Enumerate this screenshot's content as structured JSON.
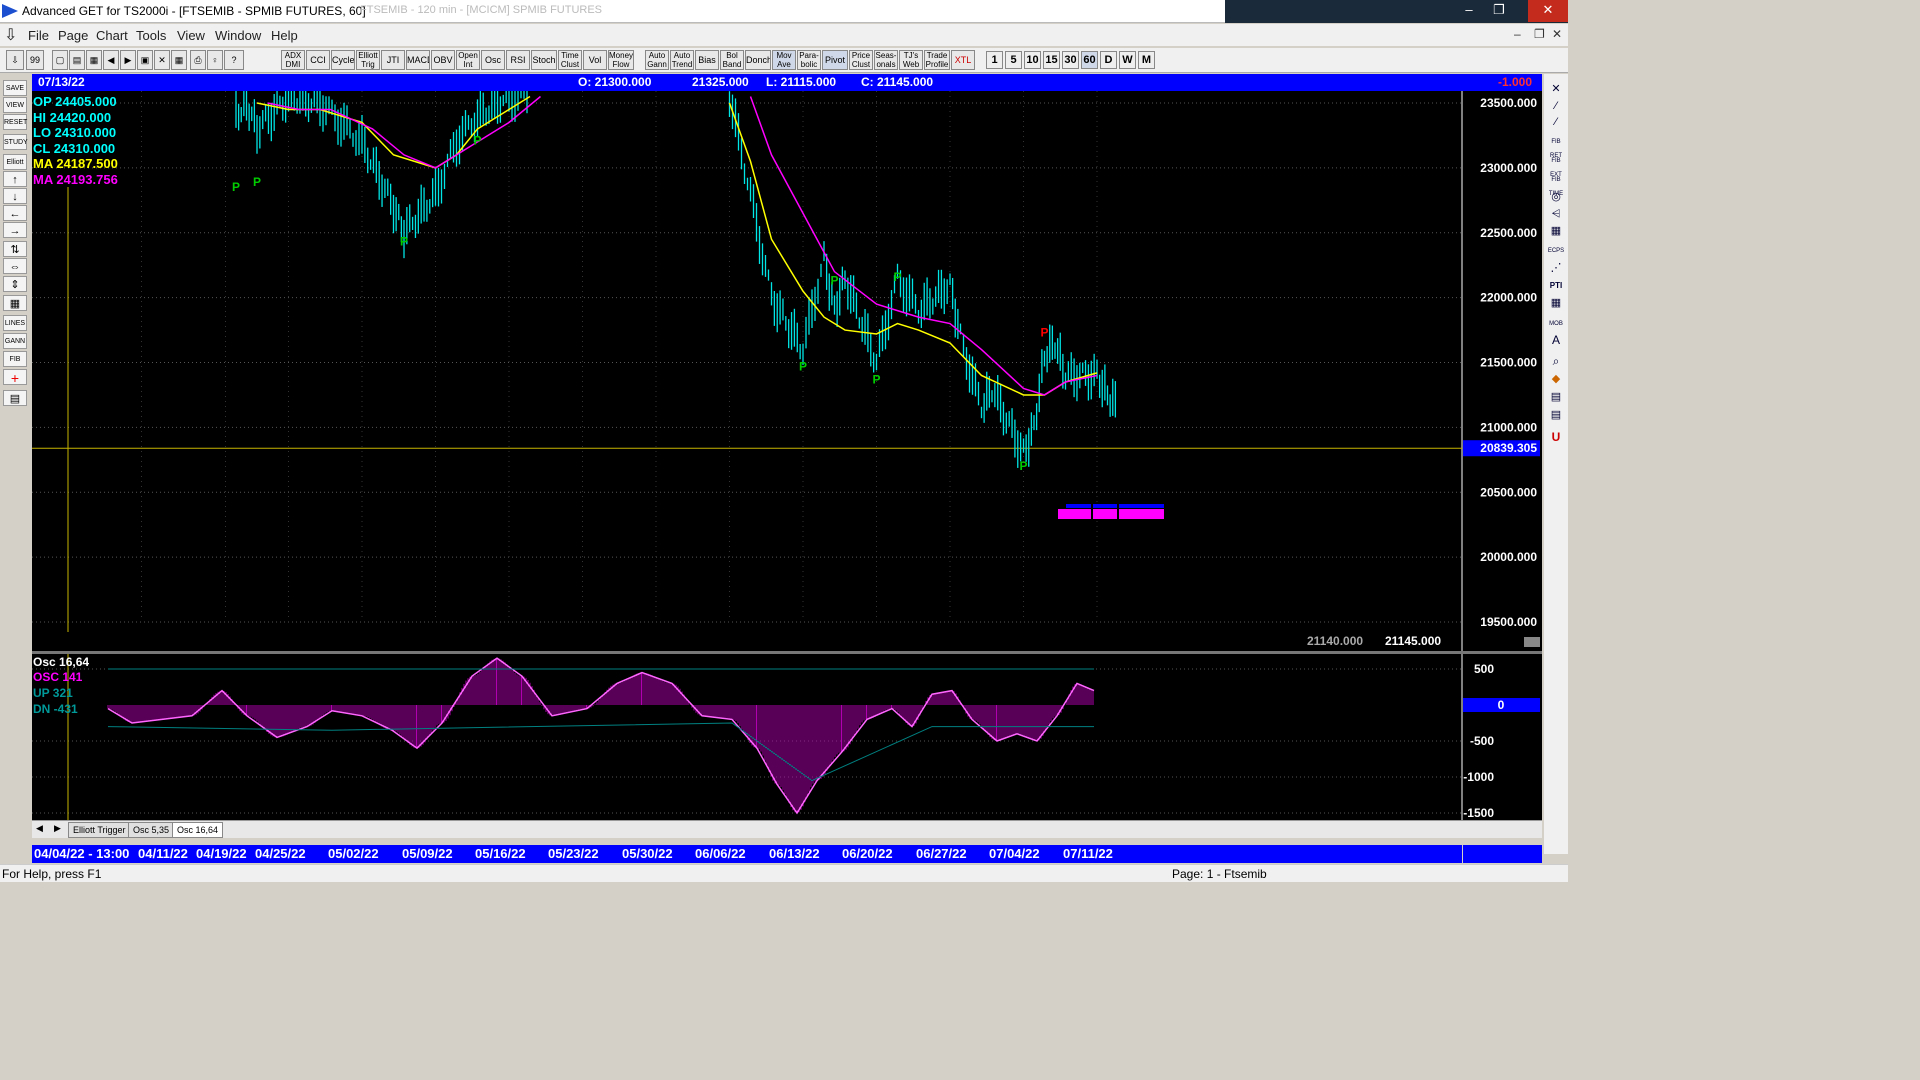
{
  "window": {
    "title": "Advanced GET for TS2000i - [FTSEMIB - SPMIB FUTURES, 60]",
    "ghost_title": "FTSEMIB - 120 min - [MCICM] SPMIB FUTURES",
    "minimize": "–",
    "maximize": "❐",
    "close": "✕"
  },
  "menu": {
    "items": [
      "File",
      "Page",
      "Chart",
      "Tools",
      "View",
      "Window",
      "Help"
    ],
    "mdi_minimize": "–",
    "mdi_restore": "❐",
    "mdi_close": "✕"
  },
  "toolbar": {
    "indicators": [
      "ADX DMI",
      "CCI",
      "Cycles",
      "Elliott Trig",
      "JTI",
      "MACD",
      "OBV",
      "Open Int",
      "Osc",
      "RSI",
      "Stoch",
      "Time Clust",
      "Vol",
      "Money Flow",
      "Auto Gann",
      "Auto Trend",
      "Bias",
      "Bol Band",
      "Donch",
      "Mov Ave",
      "Para-bolic",
      "Pivot",
      "Price Clust",
      "Seas-onals",
      "TJ's Web",
      "Trade Profile",
      "XTL"
    ],
    "timeframes": [
      "1",
      "5",
      "10",
      "15",
      "30",
      "60",
      "D",
      "W",
      "M"
    ]
  },
  "left_tools": [
    "SAVE",
    "VIEW",
    "RESET",
    "STUDY",
    "Elliott",
    "↑",
    "↓",
    "←",
    "→",
    "⇅",
    "⇔",
    "⇕",
    "▦",
    "LINES",
    "GANN",
    "FIB",
    "+",
    "▤"
  ],
  "right_tools": [
    "✕",
    "⁄",
    "⁄",
    "FIB RET",
    "FIB EXT",
    "FIB TIME",
    "◎",
    "⩤",
    "▦",
    "ECPS",
    "⋰",
    "PTI",
    "▦",
    "MOB",
    "A",
    "⌕",
    "◆",
    "▤",
    "▤",
    "U"
  ],
  "infobar": {
    "date": "07/13/22",
    "open": "O: 21300.000",
    "high": "21325.000",
    "low": "L: 21115.000",
    "close": "C: 21145.000",
    "change": "-1.000"
  },
  "legend": {
    "op": "OP  24405.000",
    "hi": "HI   24420.000",
    "lo": "LO  24310.000",
    "cl": "CL  24310.000",
    "ma": "MA  24187.500",
    "ma2": "MA  24193.756"
  },
  "price_axis": {
    "ticks": [
      "23500.000",
      "23000.000",
      "22500.000",
      "22000.000",
      "21500.000",
      "21000.000",
      "20500.000",
      "20000.000",
      "19500.000"
    ],
    "tick_values": [
      23500,
      23000,
      22500,
      22000,
      21500,
      21000,
      20500,
      20000,
      19500
    ],
    "cursor_value": 20839.305,
    "cursor_label": "20839.305",
    "cursor_price": "21140.000",
    "last_price": "21145.000"
  },
  "pivots": [
    {
      "label": "P",
      "date": "04/20/22",
      "price": 22820,
      "color": "#00cc00"
    },
    {
      "label": "P",
      "date": "04/22/22",
      "price": 22860,
      "color": "#00cc00"
    },
    {
      "label": "P",
      "date": "05/06/22",
      "price": 22400,
      "color": "#00cc00"
    },
    {
      "label": "P",
      "date": "05/13/22",
      "price": 23180,
      "color": "#00cc00"
    },
    {
      "label": "P",
      "date": "06/13/22",
      "price": 21440,
      "color": "#00cc00"
    },
    {
      "label": "P",
      "date": "06/16/22",
      "price": 22100,
      "color": "#00cc00"
    },
    {
      "label": "P",
      "date": "06/20/22",
      "price": 21340,
      "color": "#00cc00"
    },
    {
      "label": "P",
      "date": "06/22/22",
      "price": 22130,
      "color": "#00cc00"
    },
    {
      "label": "P",
      "date": "07/04/22",
      "price": 20670,
      "color": "#00cc00"
    },
    {
      "label": "P",
      "date": "07/06/22",
      "price": 21700,
      "color": "#ff0000"
    }
  ],
  "oscillator": {
    "title": "Osc 16,64",
    "osc": "OSC 141",
    "up": "UP   321",
    "dn": "DN   -431",
    "ticks": [
      "500",
      "-500",
      "-1000",
      "-1500"
    ],
    "tick_values": [
      500,
      -500,
      -1000,
      -1500
    ],
    "zero_label": "0"
  },
  "tabs": [
    "Elliott Trigger",
    "Osc 5,35",
    "Osc 16,64"
  ],
  "dates": [
    "04/04/22 - 13:00",
    "04/11/22",
    "04/19/22",
    "04/25/22",
    "05/02/22",
    "05/09/22",
    "05/16/22",
    "05/23/22",
    "05/30/22",
    "06/06/22",
    "06/13/22",
    "06/20/22",
    "06/27/22",
    "07/04/22",
    "07/11/22"
  ],
  "status": {
    "help": "For Help, press F1",
    "page": "Page: 1 - Ftsemib"
  }
}
